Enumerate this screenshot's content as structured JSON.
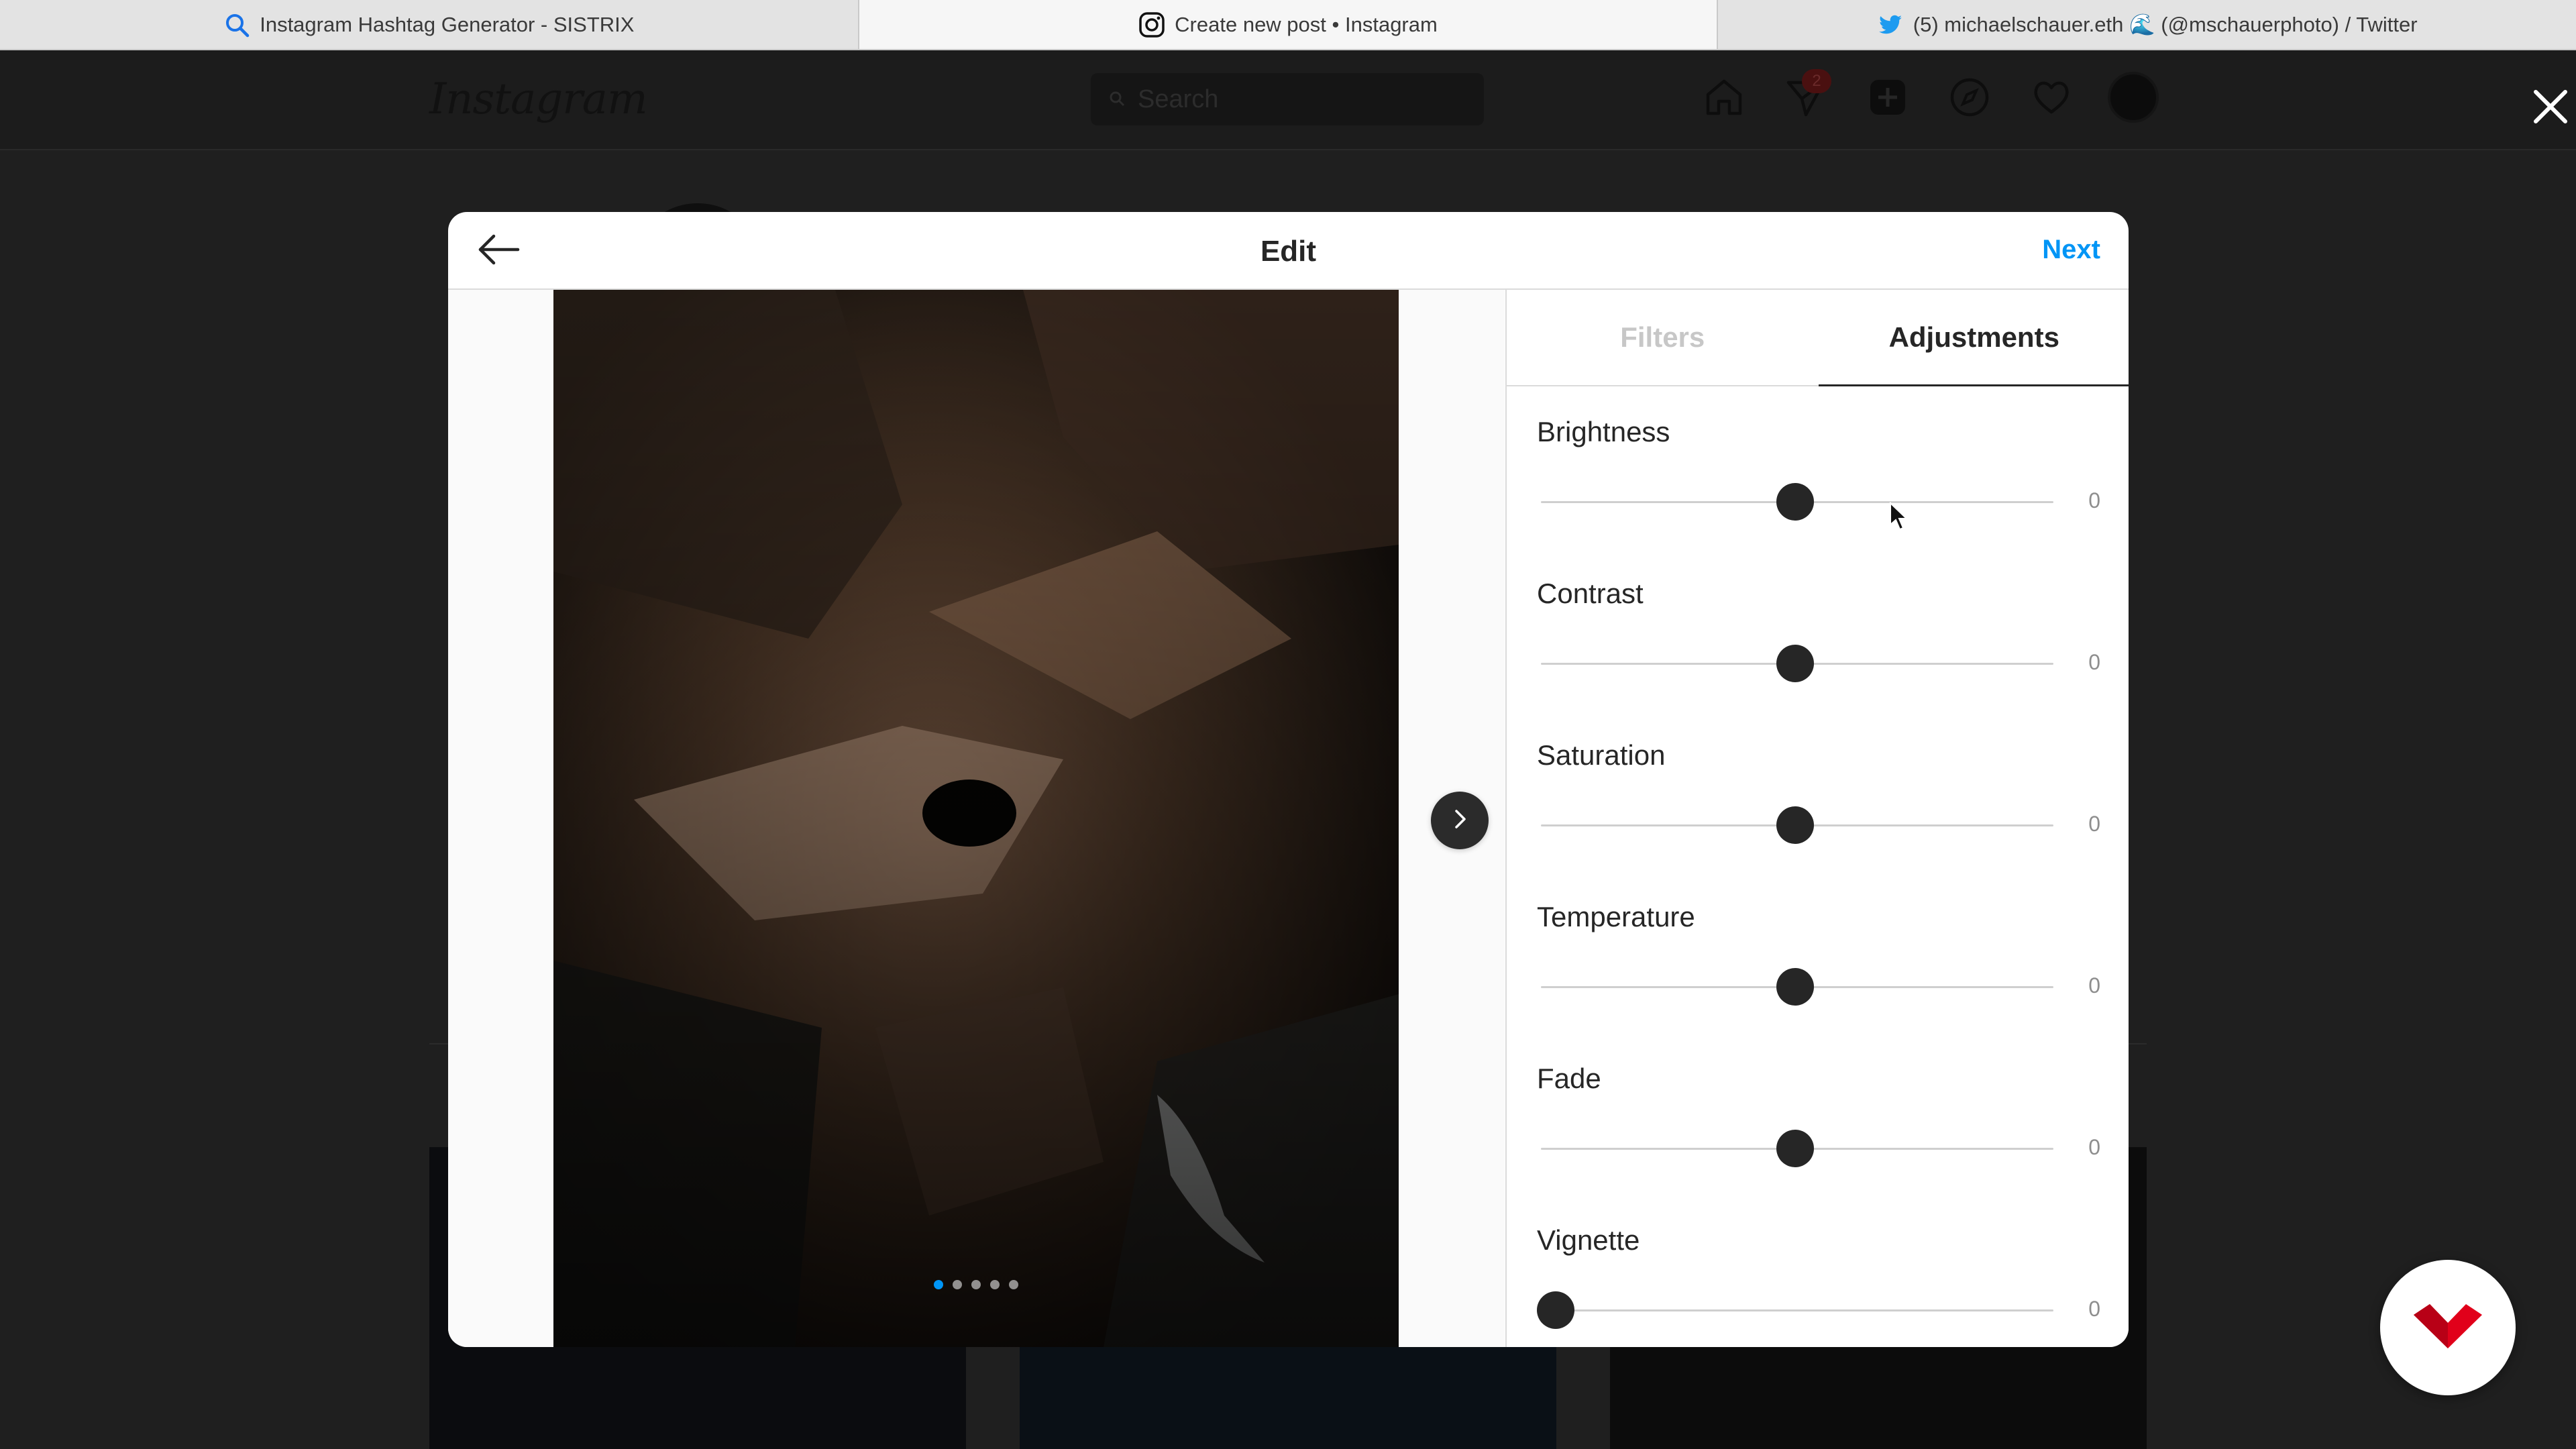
{
  "browser": {
    "tabs": [
      {
        "title": "Instagram Hashtag Generator - SISTRIX",
        "icon": "search-icon",
        "active": false
      },
      {
        "title": "Create new post • Instagram",
        "icon": "instagram-icon",
        "active": true
      },
      {
        "title": "(5) michaelschauer.eth 🌊 (@mschauerphoto) / Twitter",
        "icon": "twitter-icon",
        "active": false
      }
    ]
  },
  "instagram": {
    "logo": "Instagram",
    "search_placeholder": "Search",
    "notification_count": "2",
    "nav_icons": [
      "home-icon",
      "direct-icon",
      "new-post-icon",
      "explore-icon",
      "activity-icon",
      "profile-avatar"
    ]
  },
  "modal": {
    "title": "Edit",
    "next_label": "Next",
    "carousel": {
      "count": 5,
      "active_index": 0
    },
    "tabs": [
      {
        "label": "Filters",
        "active": false
      },
      {
        "label": "Adjustments",
        "active": true
      }
    ],
    "adjustments": [
      {
        "label": "Brightness",
        "value": "0",
        "min": -100,
        "max": 100
      },
      {
        "label": "Contrast",
        "value": "0",
        "min": -100,
        "max": 100
      },
      {
        "label": "Saturation",
        "value": "0",
        "min": -100,
        "max": 100
      },
      {
        "label": "Temperature",
        "value": "0",
        "min": -100,
        "max": 100
      },
      {
        "label": "Fade",
        "value": "0",
        "min": -100,
        "max": 100
      },
      {
        "label": "Vignette",
        "value": "0",
        "min": 0,
        "max": 100
      }
    ]
  },
  "colors": {
    "accent": "#0095f6",
    "overlay": "#262626",
    "brand_red": "#e1001a"
  }
}
